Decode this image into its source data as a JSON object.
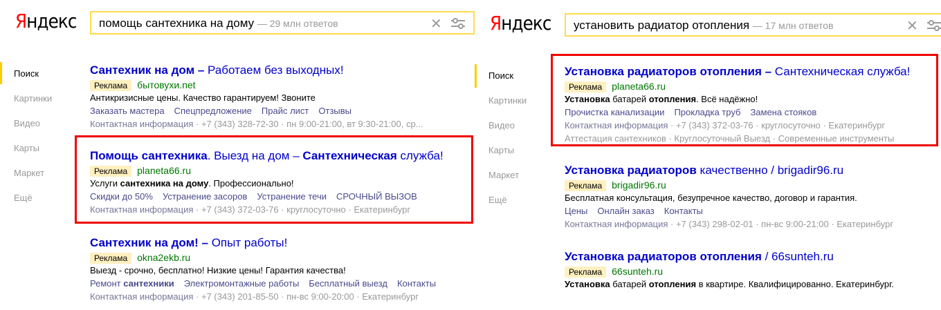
{
  "brand": {
    "letter1": "Я",
    "rest": "ндекс"
  },
  "left": {
    "query": "помощь сантехника на дому",
    "count": "— 29 млн ответов",
    "nav": [
      "Поиск",
      "Картинки",
      "Видео",
      "Карты",
      "Маркет",
      "Ещё"
    ],
    "results": [
      {
        "t1": "Сантехник на дом – ",
        "t2": "Работаем без выходных!",
        "ad": "Реклама",
        "domain": "бытовухи.net",
        "text": "Антикризисные цены. Качество гарантируем! Звоните",
        "links": [
          "Заказать мастера",
          "Спецпредложение",
          "Прайс лист",
          "Отзывы"
        ],
        "contact": "Контактная информация",
        "meta": " · +7 (343) 328-72-30 · пн 9:00-21:00, вт 9:30-21:00, ср..."
      },
      {
        "t1": "Помощь сантехника",
        "t2": ". Выезд на дом – ",
        "t3": "Сантехническая",
        "t4": " служба!",
        "ad": "Реклама",
        "domain": "planeta66.ru",
        "text_pre": "Услуги ",
        "text_b": "сантехника на дому",
        "text_post": ". Профессионально!",
        "links": [
          "Скидки до 50%",
          "Устранение засоров",
          "Устранение течи",
          "СРОЧНЫЙ ВЫЗОВ"
        ],
        "contact": "Контактная информация",
        "meta": " · +7 (343) 372-03-76 · круглосуточно · Екатеринбург"
      },
      {
        "t1": "Сантехник на дом! – ",
        "t2": "Опыт работы!",
        "ad": "Реклама",
        "domain": "okna2ekb.ru",
        "text": "Выезд - срочно, бесплатно! Низкие цены! Гарантия качества!",
        "link0_pre": "Ремонт ",
        "link0_b": "сантехники",
        "links": [
          "Электромонтажные работы",
          "Бесплатный выезд",
          "Контакты"
        ],
        "contact": "Контактная информация",
        "meta": " · +7 (343) 201-85-50 · пн-вс 9:00-20:00 · Екатеринбург"
      }
    ]
  },
  "right": {
    "query": "установить радиатор отопления",
    "count": "— 17 млн ответов",
    "nav": [
      "Поиск",
      "Картинки",
      "Видео",
      "Карты",
      "Маркет",
      "Ещё"
    ],
    "results": [
      {
        "t1": "Установка радиаторов отопления – ",
        "t2": "Сантехническая служба!",
        "ad": "Реклама",
        "domain": "planeta66.ru",
        "text_b1": "Установка",
        "text_mid": " батарей ",
        "text_b2": "отопления",
        "text_post": ". Всё надёжно!",
        "links": [
          "Прочистка канализации",
          "Прокладка труб",
          "Замена стояков"
        ],
        "contact": "Контактная информация",
        "meta": " · +7 (343) 372-03-76 · круглосуточно · Екатеринбург",
        "extra": "Аттестация сантехников · Круглосуточный Выезд · Современные инструменты"
      },
      {
        "t1": "Установка радиаторов",
        "t2": " качественно / brigadir96.ru",
        "ad": "Реклама",
        "domain": "brigadir96.ru",
        "text": "Бесплатная консультация, безупречное качество, договор и гарантия.",
        "links": [
          "Цены",
          "Онлайн заказ",
          "Контакты"
        ],
        "contact": "Контактная информация",
        "meta": " · +7 (343) 298-02-01 · пн-вс 9:00-21:00 · Екатеринбург"
      },
      {
        "t1": "Установка радиаторов отопления",
        "t2": " / 66sunteh.ru",
        "ad": "Реклама",
        "domain": "66sunteh.ru",
        "text_b1": "Установка",
        "text_mid": " батарей ",
        "text_b2": "отопления",
        "text_post": " в квартире. Квалифицированно. Екатеринбург."
      }
    ]
  }
}
